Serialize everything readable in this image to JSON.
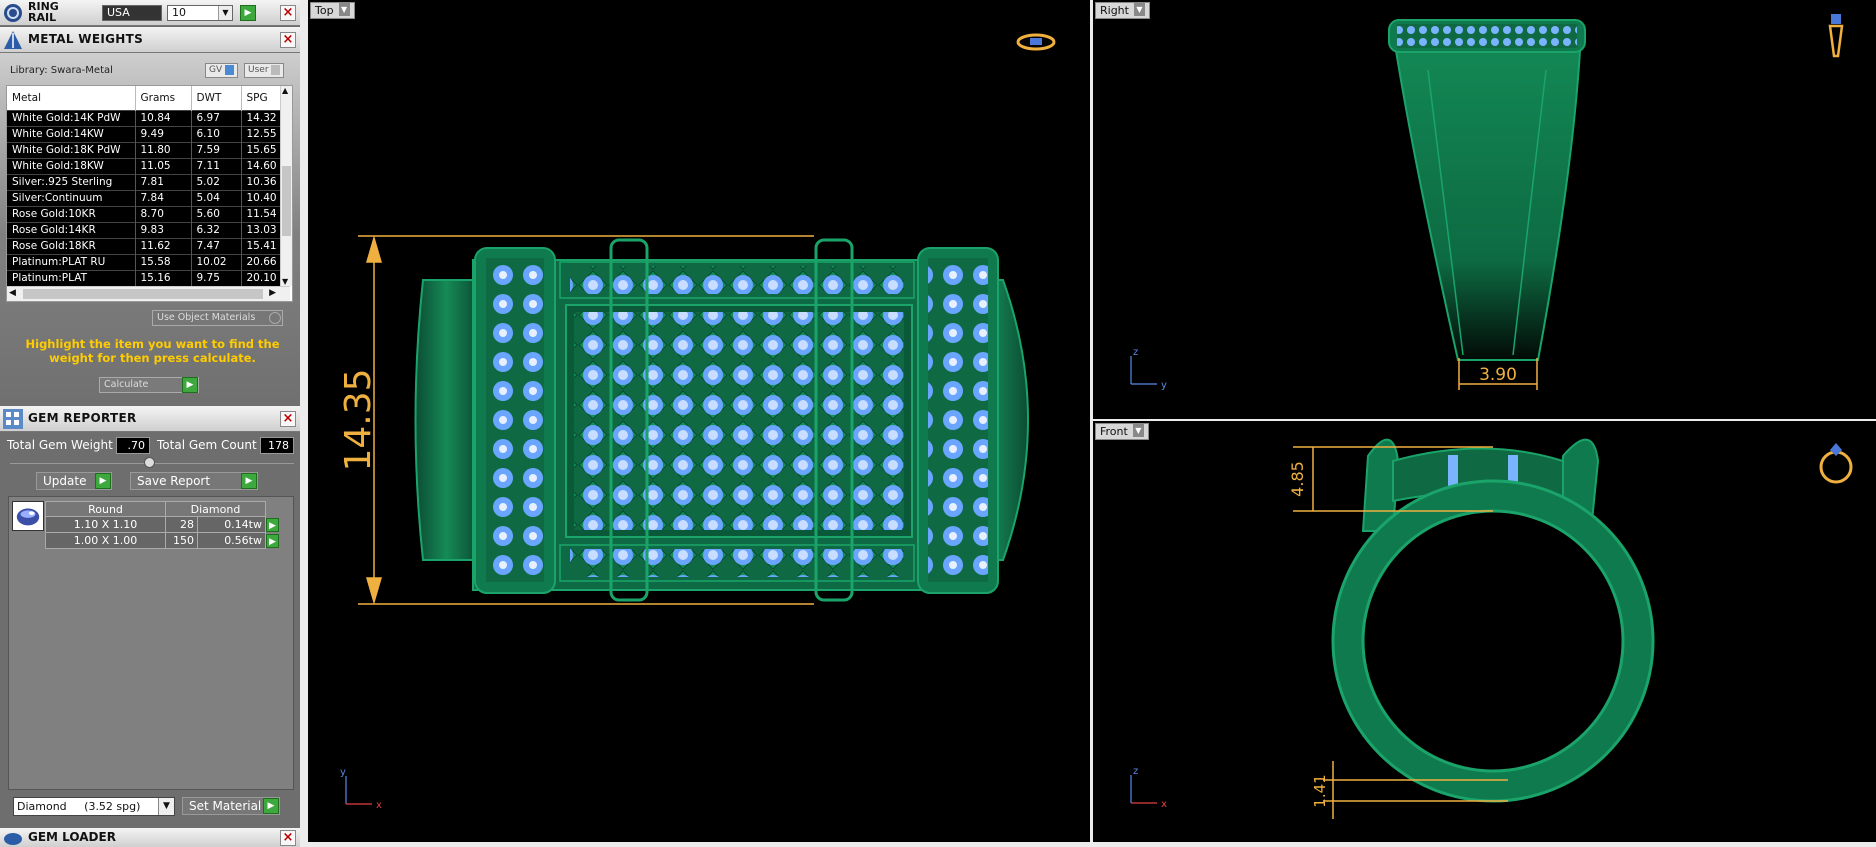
{
  "ring_rail": {
    "title": "RING\nRAIL",
    "standard": "USA",
    "size": "10"
  },
  "metal_weights": {
    "title": "METAL WEIGHTS",
    "library": "Library: Swara-Metal",
    "gv_label": "GV",
    "user_label": "User",
    "columns": [
      "Metal",
      "Grams",
      "DWT",
      "SPG"
    ],
    "rows": [
      [
        "White Gold:14K PdW",
        "10.84",
        "6.97",
        "14.32"
      ],
      [
        "White Gold:14KW",
        "9.49",
        "6.10",
        "12.55"
      ],
      [
        "White Gold:18K PdW",
        "11.80",
        "7.59",
        "15.65"
      ],
      [
        "White Gold:18KW",
        "11.05",
        "7.11",
        "14.60"
      ],
      [
        "Silver:.925 Sterling",
        "7.81",
        "5.02",
        "10.36"
      ],
      [
        "Silver:Continuum",
        "7.84",
        "5.04",
        "10.40"
      ],
      [
        "Rose Gold:10KR",
        "8.70",
        "5.60",
        "11.54"
      ],
      [
        "Rose Gold:14KR",
        "9.83",
        "6.32",
        "13.03"
      ],
      [
        "Rose Gold:18KR",
        "11.62",
        "7.47",
        "15.41"
      ],
      [
        "Platinum:PLAT RU",
        "15.58",
        "10.02",
        "20.66"
      ],
      [
        "Platinum:PLAT",
        "15.16",
        "9.75",
        "20.10"
      ]
    ],
    "use_object_materials": "Use Object Materials",
    "hint": "Highlight the item you want to find the weight for then press calculate.",
    "calculate": "Calculate"
  },
  "gem_reporter": {
    "title": "GEM REPORTER",
    "total_weight_label": "Total Gem Weight",
    "total_weight_value": ".70",
    "total_count_label": "Total Gem Count",
    "total_count_value": "178",
    "update_label": "Update",
    "save_report_label": "Save Report",
    "grid_headers": [
      "Round",
      "Diamond"
    ],
    "grid_rows": [
      {
        "size": "1.10 X 1.10",
        "count": "28",
        "weight": "0.14tw"
      },
      {
        "size": "1.00 X 1.00",
        "count": "150",
        "weight": "0.56tw"
      }
    ],
    "material": "Diamond     (3.52 spg)",
    "set_material_label": "Set Material"
  },
  "gem_loader": {
    "title": "GEM LOADER"
  },
  "viewports": {
    "top": {
      "label": "Top",
      "dimension": "14.35",
      "axis_v": "y",
      "axis_h": "x"
    },
    "right": {
      "label": "Right",
      "dimension": "3.90",
      "axis_v": "z",
      "axis_h": "y"
    },
    "front": {
      "label": "Front",
      "dimension_top": "4.85",
      "dimension_bottom": "1.41",
      "axis_v": "z",
      "axis_h": "x"
    }
  },
  "colors": {
    "metal": "#1a8a5a",
    "gem": "#7ab4ff",
    "dimension": "#f0b040",
    "viewport_bg": "#000000"
  }
}
